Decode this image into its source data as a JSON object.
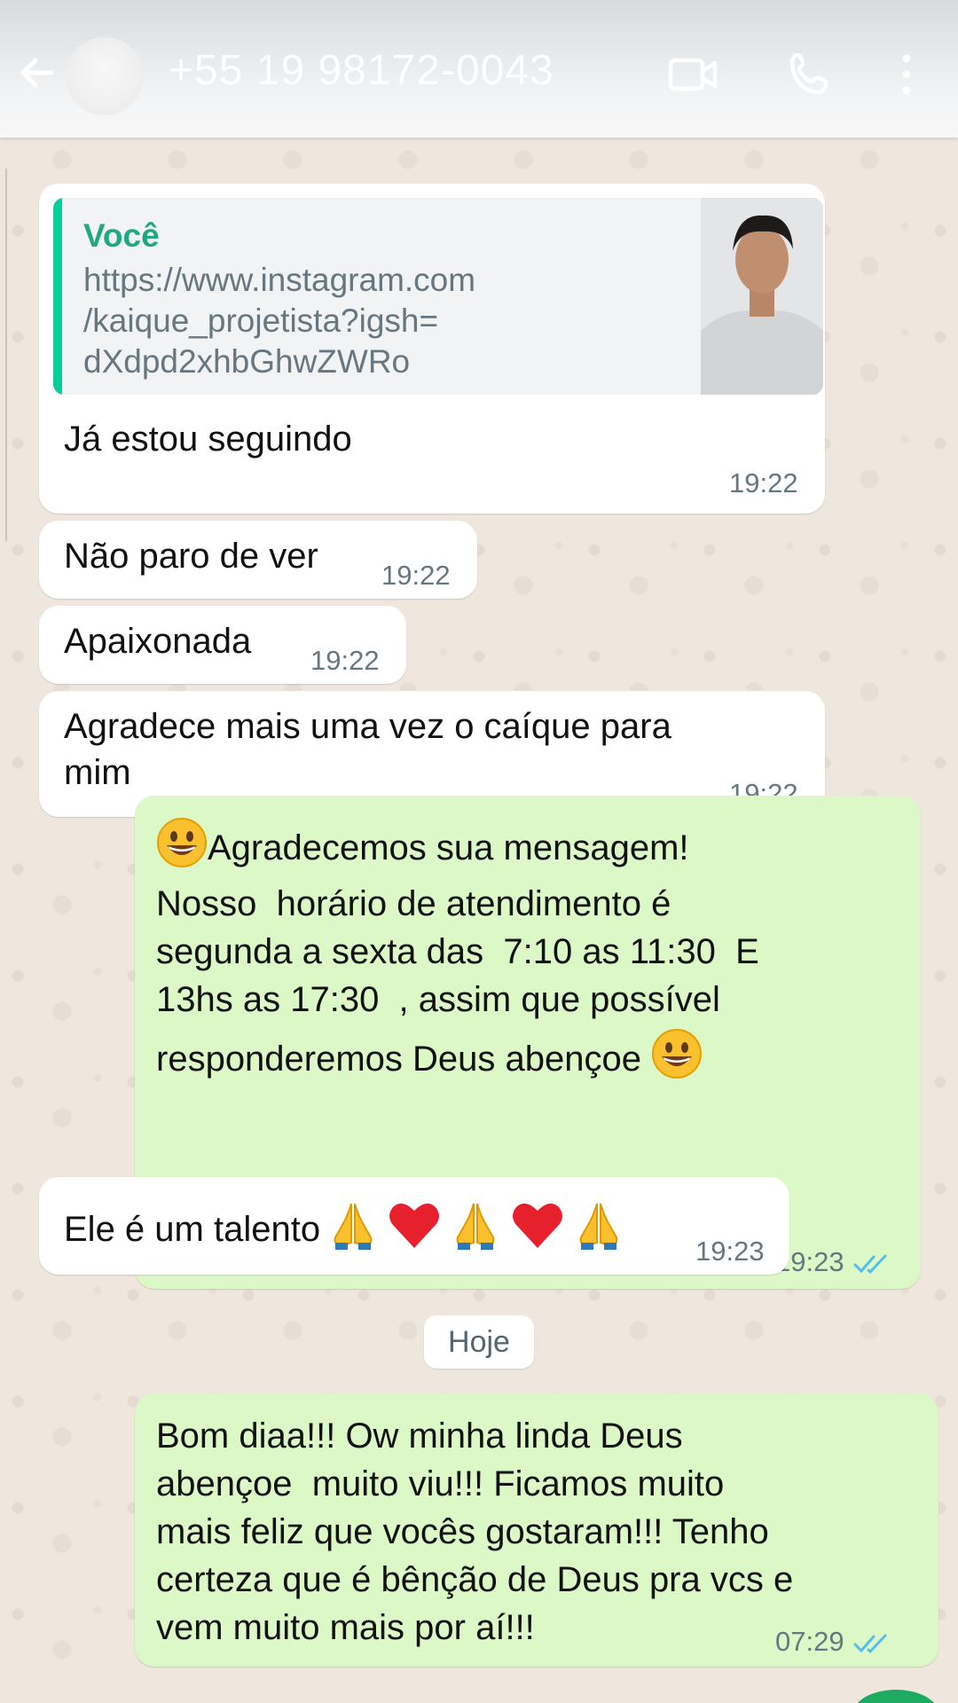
{
  "header": {
    "contact": "+55 19 98172-0043"
  },
  "messages": [
    {
      "id": "m1",
      "direction": "incoming",
      "quote": {
        "author": "Você",
        "lines": [
          "https://www.instagram.com",
          "/kaique_projetista?igsh=",
          "dXdpd2xhbGhwZWRo"
        ]
      },
      "text": "Já estou seguindo",
      "time": "19:22"
    },
    {
      "id": "m2",
      "direction": "incoming",
      "text": "Não paro de ver",
      "time": "19:22"
    },
    {
      "id": "m3",
      "direction": "incoming",
      "text": "Apaixonada",
      "time": "19:22"
    },
    {
      "id": "m4",
      "direction": "incoming",
      "lines": [
        "Agradece mais uma vez o caíque para",
        "mim"
      ],
      "time": "19:22"
    },
    {
      "id": "m5",
      "direction": "outgoing",
      "lines": [
        "Agradecemos sua mensagem!",
        "Nosso  horário de atendimento é",
        "segunda a sexta das  7:10 as 11:30  E",
        "13hs as 17:30  , assim que possível",
        "responderemos Deus abençoe"
      ],
      "time": "19:23",
      "status": "read"
    },
    {
      "id": "m6",
      "direction": "incoming",
      "text": "Ele é um talento",
      "time": "19:23"
    },
    {
      "id": "m7",
      "direction": "outgoing",
      "lines": [
        "Bom diaa!!! Ow minha linda Deus",
        "abençoe  muito viu!!! Ficamos muito",
        "mais feliz que vocês gostaram!!! Tenho",
        "certeza que é bênção de Deus pra vcs e",
        "vem muito mais por aí!!!"
      ],
      "time": "07:29",
      "status": "read"
    }
  ],
  "day_separator": "Hoje",
  "colors": {
    "incoming": "#ffffff",
    "outgoing": "#dcf8c6",
    "quote_accent": "#06cf9c",
    "read_ticks": "#53bdeb"
  }
}
